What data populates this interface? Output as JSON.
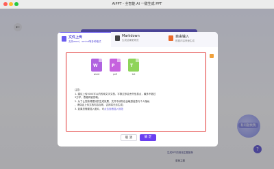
{
  "window": {
    "title": "AiPPT - 全智能 AI 一键生成 PPT"
  },
  "background": {
    "back_icon": "arrow-left-icon",
    "prompt_text": "AI一键生成PPT，智能排版、海量模板任你选，请问您想要生成什么样的PPT呢？",
    "right_cards": [
      {
        "label": "markdown",
        "color": "#3a8dde"
      },
      {
        "label": "Freemind",
        "color": "#ef6a3a"
      },
      {
        "label": "xmind",
        "color": "#e84d5b"
      }
    ],
    "mascot_label": "有问题找我",
    "bottom_link": "生成PPT的常用主题推荐",
    "bottom_link2": "更换主题",
    "help_icon": "question-icon"
  },
  "modal": {
    "tabs": [
      {
        "title": "文件上传",
        "subtitle": "支持word、xmind等多种格式",
        "icon_color": "#6a5cf0"
      },
      {
        "title": "Markdown",
        "subtitle": "生成结果更规范",
        "icon_color": "#444444"
      },
      {
        "title": "自由输入",
        "subtitle": "根据内容快速生成",
        "icon_color": "#e96a2b"
      }
    ],
    "file_types": [
      {
        "label": "word",
        "mark": "W",
        "color": "#b062e0"
      },
      {
        "label": "pdf",
        "mark": "P",
        "color": "#c662de"
      },
      {
        "label": "txt",
        "mark": "T",
        "color": "#8ed45a"
      }
    ],
    "notes": {
      "title": "注意：",
      "line1": "1. 建议上传5000字以内的纯文字文档，字数过多会丢失信息点，最多不超过",
      "line2": "   3万字，表格将被忽略；",
      "line3": "2. 为了让您获得更好的生成效果，文件中请勿包含敏感信息与个人隐私",
      "line4": "   ，请保证上传文档内容合规，否则将无法生成；",
      "line5_prefix": "3. 如果您需要插入图片，可",
      "line5_link": "点击查看插入规范"
    },
    "cancel_label": "取 消",
    "confirm_label": "确 定"
  }
}
